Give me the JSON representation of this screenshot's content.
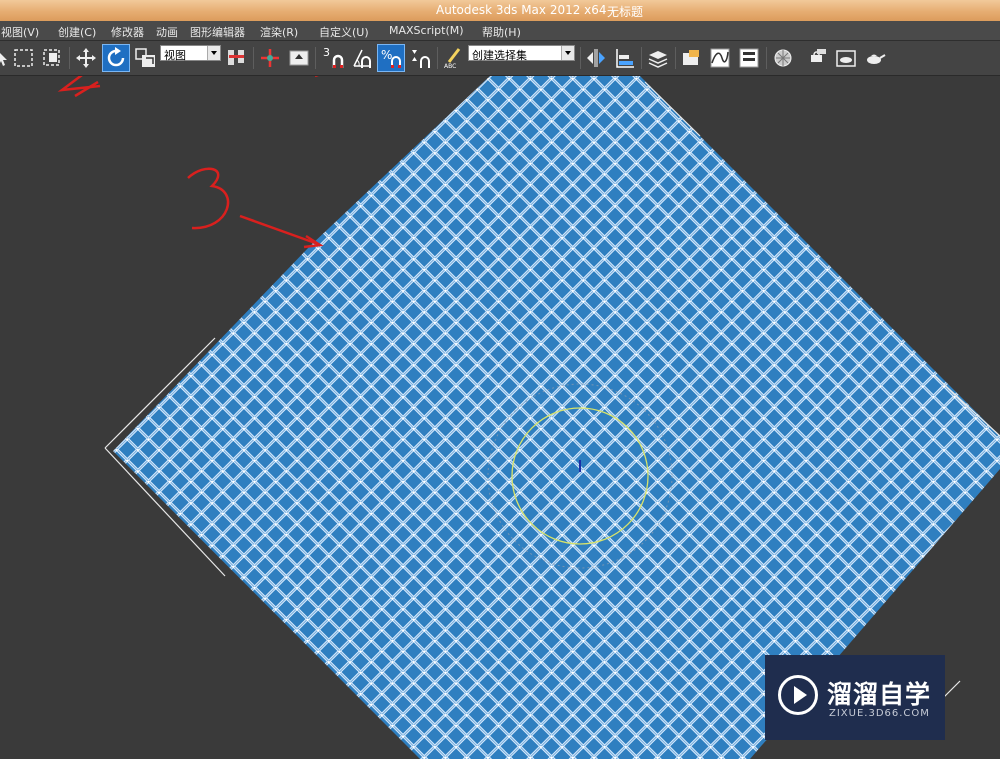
{
  "window": {
    "title": "Autodesk 3ds Max  2012 x64",
    "document": "无标题"
  },
  "menu": [
    "视图(V)",
    "创建(C)",
    "修改器",
    "动画",
    "图形编辑器",
    "渲染(R)",
    "自定义(U)",
    "MAXScript(M)",
    "帮助(H)"
  ],
  "toolbar": {
    "reference_coord": "视图",
    "snap_number": "3",
    "selection_set_placeholder": "创建选择集"
  },
  "annotations": {
    "mark_2": "2",
    "mark_3": "3"
  },
  "watermark": {
    "name": "溜溜自学",
    "url": "ZIXUE.3D66.COM"
  },
  "colors": {
    "plane_fill": "#2f7fc0",
    "grid_line": "#e6f2ff",
    "gizmo_ring": "#d8e36a",
    "annotation": "#d9201e",
    "active_tool": "#1f6fc2"
  }
}
